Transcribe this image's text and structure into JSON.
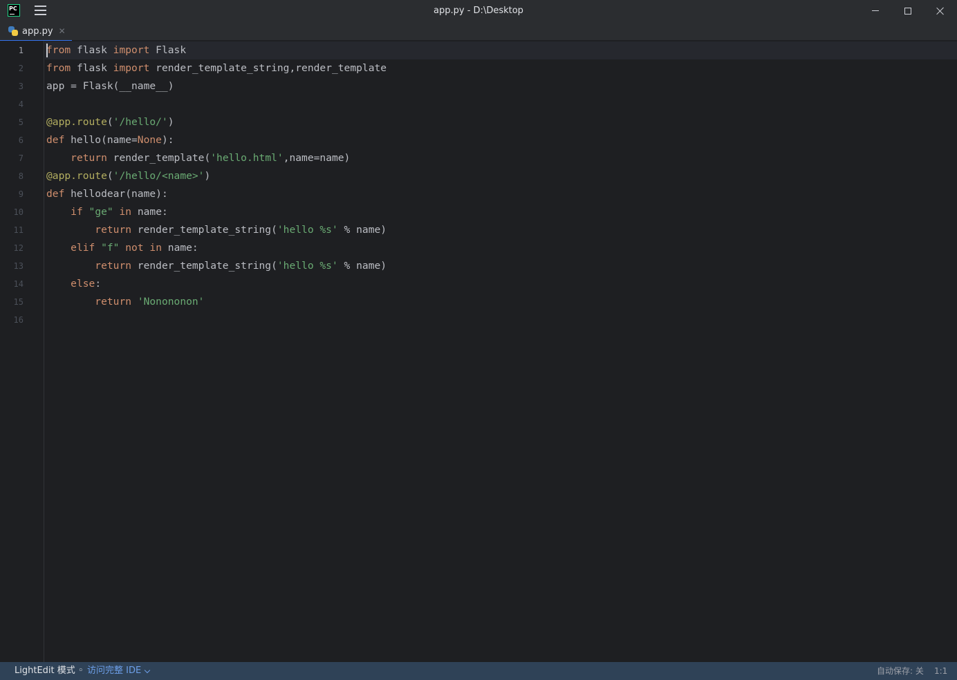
{
  "window": {
    "title": "app.py - D:\\Desktop",
    "logo_text": "PC"
  },
  "tabs": [
    {
      "label": "app.py",
      "close_glyph": "✕",
      "icon": "python-file-icon",
      "active": true
    }
  ],
  "editor": {
    "language": "python",
    "current_line": 1,
    "lines": [
      {
        "no": "1",
        "text": "from flask import Flask"
      },
      {
        "no": "2",
        "text": "from flask import render_template_string,render_template"
      },
      {
        "no": "3",
        "text": "app = Flask(__name__)"
      },
      {
        "no": "4",
        "text": ""
      },
      {
        "no": "5",
        "text": "@app.route('/hello/')"
      },
      {
        "no": "6",
        "text": "def hello(name=None):"
      },
      {
        "no": "7",
        "text": "    return render_template('hello.html',name=name)"
      },
      {
        "no": "8",
        "text": "@app.route('/hello/<name>')"
      },
      {
        "no": "9",
        "text": "def hellodear(name):"
      },
      {
        "no": "10",
        "text": "    if \"ge\" in name:"
      },
      {
        "no": "11",
        "text": "        return render_template_string('hello %s' % name)"
      },
      {
        "no": "12",
        "text": "    elif \"f\" not in name:"
      },
      {
        "no": "13",
        "text": "        return render_template_string('hello %s' % name)"
      },
      {
        "no": "14",
        "text": "    else:"
      },
      {
        "no": "15",
        "text": "        return 'Nonononon'"
      },
      {
        "no": "16",
        "text": ""
      }
    ]
  },
  "statusbar": {
    "mode_label": "LightEdit 模式 ◦",
    "ide_link": "访问完整 IDE",
    "autosave": "自动保存: 关",
    "caret_position": "1:1"
  },
  "colors": {
    "background": "#1e1f22",
    "chrome": "#2b2d30",
    "statusbar": "#2f4257",
    "keyword": "#cf8e6d",
    "string": "#6aab73",
    "decorator": "#b3ae60",
    "text": "#bcbec4",
    "accent": "#3574f0"
  }
}
